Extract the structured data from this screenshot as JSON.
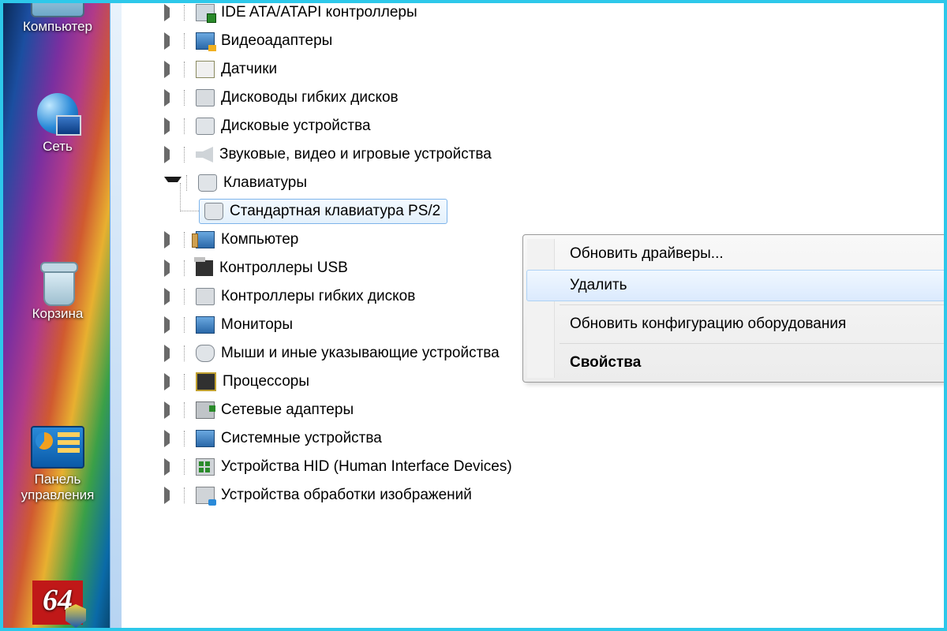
{
  "desktop": {
    "icons": [
      {
        "id": "computer",
        "label": "Компьютер"
      },
      {
        "id": "network",
        "label": "Сеть"
      },
      {
        "id": "recycle",
        "label": "Корзина"
      },
      {
        "id": "controlpanel",
        "label": "Панель управления"
      },
      {
        "id": "aida64",
        "label": "64"
      }
    ]
  },
  "tree": {
    "items": [
      {
        "icon": "ide",
        "label": "IDE ATA/ATAPI контроллеры"
      },
      {
        "icon": "vid",
        "label": "Видеоадаптеры"
      },
      {
        "icon": "sen",
        "label": "Датчики"
      },
      {
        "icon": "fdd",
        "label": "Дисководы гибких дисков"
      },
      {
        "icon": "hdd",
        "label": "Дисковые устройства"
      },
      {
        "icon": "snd",
        "label": "Звуковые, видео и игровые устройства"
      },
      {
        "icon": "kb",
        "label": "Клавиатуры",
        "expanded": true,
        "child": {
          "icon": "kb",
          "label": "Стандартная клавиатура PS/2",
          "selected": true
        }
      },
      {
        "icon": "pc",
        "label": "Компьютер"
      },
      {
        "icon": "usb",
        "label": "Контроллеры USB"
      },
      {
        "icon": "fdd",
        "label": "Контроллеры гибких дисков"
      },
      {
        "icon": "mon",
        "label": "Мониторы"
      },
      {
        "icon": "mouse",
        "label": "Мыши и иные указывающие устройства"
      },
      {
        "icon": "cpu",
        "label": "Процессоры"
      },
      {
        "icon": "nic",
        "label": "Сетевые адаптеры"
      },
      {
        "icon": "sys",
        "label": "Системные устройства"
      },
      {
        "icon": "hid",
        "label": "Устройства HID (Human Interface Devices)"
      },
      {
        "icon": "img",
        "label": "Устройства обработки изображений"
      }
    ]
  },
  "context_menu": {
    "items": [
      {
        "label": "Обновить драйверы...",
        "type": "item"
      },
      {
        "label": "Удалить",
        "type": "item",
        "hover": true
      },
      {
        "type": "sep"
      },
      {
        "label": "Обновить конфигурацию оборудования",
        "type": "item"
      },
      {
        "type": "sep"
      },
      {
        "label": "Свойства",
        "type": "item",
        "bold": true
      }
    ]
  }
}
